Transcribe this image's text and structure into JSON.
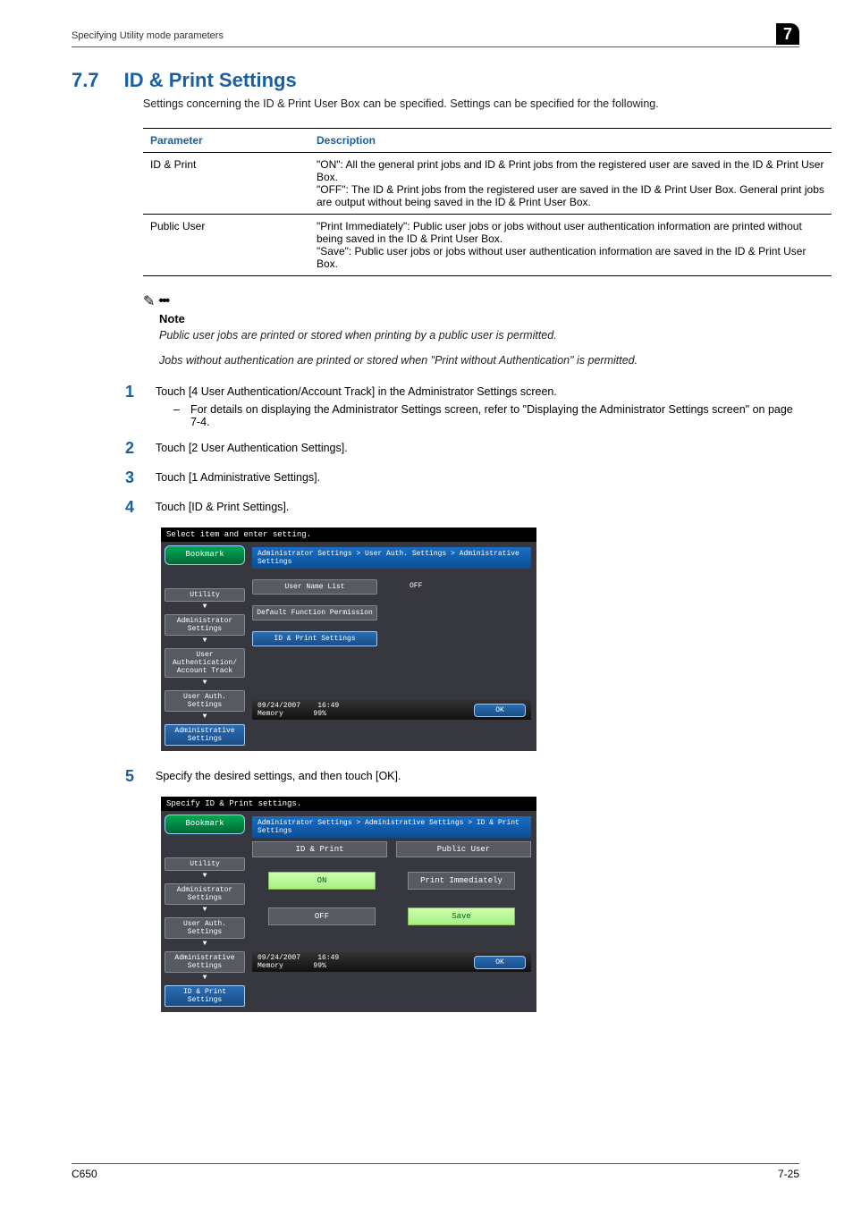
{
  "header": {
    "breadcrumb": "Specifying Utility mode parameters",
    "chapter": "7"
  },
  "section": {
    "number": "7.7",
    "title": "ID & Print Settings"
  },
  "intro": "Settings concerning the ID & Print User Box can be specified. Settings can be specified for the following.",
  "table": {
    "head_param": "Parameter",
    "head_desc": "Description",
    "rows": [
      {
        "param": "ID & Print",
        "desc": "\"ON\": All the general print jobs and ID & Print jobs from the registered user are saved in the ID & Print User Box.\n\"OFF\": The ID & Print jobs from the registered user are saved in the ID & Print User Box. General print jobs are output without being saved in the ID & Print User Box."
      },
      {
        "param": "Public User",
        "desc": "\"Print Immediately\": Public user jobs or jobs without user authentication information are printed without being saved in the ID & Print User Box.\n\"Save\": Public user jobs or jobs without user authentication information are saved in the ID & Print User Box."
      }
    ]
  },
  "note": {
    "label": "Note",
    "line1": "Public user jobs are printed or stored when printing by a public user is permitted.",
    "line2": "Jobs without authentication are printed or stored when \"Print without Authentication\" is permitted."
  },
  "steps": {
    "s1": "Touch [4 User Authentication/Account Track] in the Administrator Settings screen.",
    "s1_sub": "For details on displaying the Administrator Settings screen, refer to \"Displaying the Administrator Settings screen\" on page 7-4.",
    "s2": "Touch [2 User Authentication Settings].",
    "s3": "Touch [1 Administrative Settings].",
    "s4": "Touch [ID & Print Settings].",
    "s5": "Specify the desired settings, and then touch [OK]."
  },
  "shot1": {
    "msg": "Select item and enter setting.",
    "crumb": "Administrator Settings > User Auth. Settings > Administrative Settings",
    "bookmark": "Bookmark",
    "side": [
      "Utility",
      "Administrator Settings",
      "User Authentication/ Account Track",
      "User Auth. Settings",
      "Administrative Settings"
    ],
    "opts": [
      "User Name List",
      "Default Function Permission",
      "ID & Print Settings"
    ],
    "off": "OFF",
    "status_l1": "09/24/2007",
    "status_l2": "16:49",
    "status_l3": "Memory",
    "status_l4": "99%",
    "ok": "OK"
  },
  "shot2": {
    "msg": "Specify ID & Print settings.",
    "crumb": "Administrator Settings > Administrative Settings > ID & Print Settings",
    "bookmark": "Bookmark",
    "side": [
      "Utility",
      "Administrator Settings",
      "User Auth. Settings",
      "Administrative Settings",
      "ID & Print Settings"
    ],
    "col1": "ID & Print",
    "col2": "Public User",
    "b1": "ON",
    "b2": "Print Immediately",
    "b3": "OFF",
    "b4": "Save",
    "status_l1": "09/24/2007",
    "status_l2": "16:49",
    "status_l3": "Memory",
    "status_l4": "99%",
    "ok": "OK"
  },
  "footer": {
    "left": "C650",
    "right": "7-25"
  }
}
